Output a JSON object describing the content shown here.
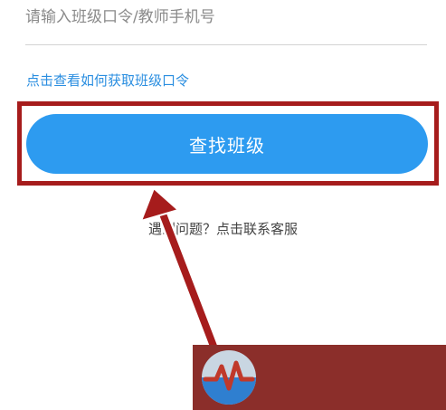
{
  "form": {
    "input_placeholder": "请输入班级口令/教师手机号",
    "input_value": "",
    "help_link": "点击查看如何获取班级口令",
    "find_button": "查找班级"
  },
  "footer": {
    "question": "遇到问题？",
    "contact": "点击联系客服"
  },
  "colors": {
    "accent_blue": "#2d9bf0",
    "link_blue": "#2a8ee0",
    "highlight_red": "#a61c1c",
    "watermark_bg": "#8b2e2a"
  },
  "icons": {
    "watermark_logo": "heartbeat-logo-icon"
  }
}
